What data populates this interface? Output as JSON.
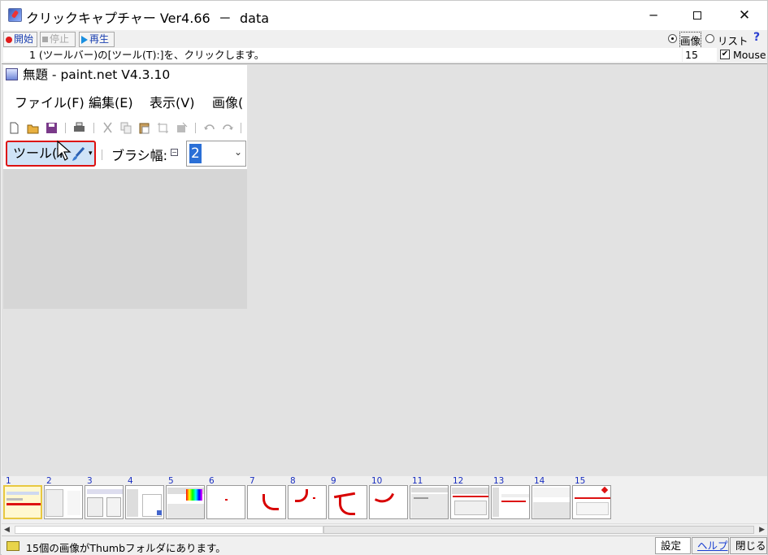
{
  "window": {
    "title": "クリックキャプチャー Ver4.66  －  data",
    "minimize": "─",
    "close": "✕"
  },
  "toolbar": {
    "start_label": "開始",
    "stop_label": "停止",
    "play_label": "再生",
    "view_image_label": "画像",
    "view_list_label": "リスト",
    "selected_view": "画像",
    "help_symbol": "?"
  },
  "info": {
    "step_description": "1 (ツールバー)の[ツール(T):]を、クリックします。",
    "total_count": "15",
    "mouse_label": "Mouse",
    "mouse_checked": true
  },
  "screenshot": {
    "window_title": "無題 - paint.net V4.3.10",
    "menu": [
      "ファイル(F)",
      "編集(E)",
      "表示(V)",
      "画像("
    ],
    "tool_button_label": "ツール(T",
    "brush_width_label": "ブラシ幅:",
    "brush_width_value": "2"
  },
  "thumbnails": [
    {
      "num": "1",
      "selected": true
    },
    {
      "num": "2"
    },
    {
      "num": "3"
    },
    {
      "num": "4"
    },
    {
      "num": "5"
    },
    {
      "num": "6"
    },
    {
      "num": "7"
    },
    {
      "num": "8"
    },
    {
      "num": "9"
    },
    {
      "num": "10"
    },
    {
      "num": "11"
    },
    {
      "num": "12"
    },
    {
      "num": "13"
    },
    {
      "num": "14"
    },
    {
      "num": "15"
    }
  ],
  "status": {
    "message": "15個の画像がThumbフォルダにあります。",
    "settings_label": "設定",
    "help_label": "ヘルプ",
    "close_label": "閉じる"
  },
  "colors": {
    "highlight_border": "#dd1111",
    "link_blue": "#1a3fd0",
    "scribble_red": "#d80000"
  }
}
